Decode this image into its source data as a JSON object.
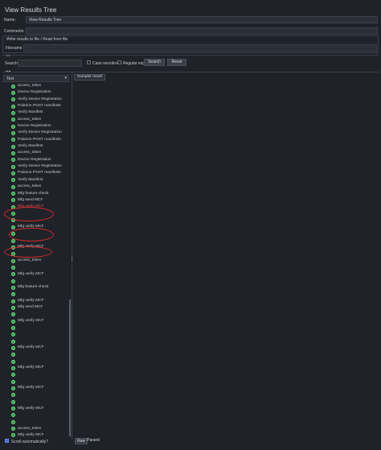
{
  "window": {
    "title": "View Results Tree"
  },
  "form": {
    "name_label": "Name:",
    "name_value": "View Results Tree",
    "comments_label": "Comments:",
    "comments_value": "",
    "file_section_label": "Write results to file / Read from file",
    "filename_label": "Filename",
    "filename_value": ""
  },
  "search": {
    "label": "Search:",
    "value": "",
    "case_sensitive_label": "Case sensitive",
    "case_sensitive_checked": false,
    "regex_label": "Regular exp.",
    "regex_checked": false,
    "search_button": "Search",
    "reset_button": "Reset"
  },
  "renderer": {
    "selected": "Text"
  },
  "result_tabs": {
    "sampler_result": "Sampler result"
  },
  "tree": {
    "items": [
      {
        "label": "access_token",
        "highlight": false
      },
      {
        "label": "Device Registration",
        "highlight": false
      },
      {
        "label": "Verify Device Registration",
        "highlight": false
      },
      {
        "label": "Polarion POST manifests",
        "highlight": false
      },
      {
        "label": "Verify Manifest",
        "highlight": false
      },
      {
        "label": "access_token",
        "highlight": false
      },
      {
        "label": "Device Registration",
        "highlight": false
      },
      {
        "label": "Verify Device Registration",
        "highlight": false
      },
      {
        "label": "Polarion POST manifests",
        "highlight": false
      },
      {
        "label": "Verify Manifest",
        "highlight": false
      },
      {
        "label": "access_token",
        "highlight": false
      },
      {
        "label": "Device Registration",
        "highlight": false
      },
      {
        "label": "Verify Device Registration",
        "highlight": false
      },
      {
        "label": "Polarion POST manifests",
        "highlight": false
      },
      {
        "label": "Verify Manifest",
        "highlight": false
      },
      {
        "label": "access_token",
        "highlight": false
      },
      {
        "label": "Mfg feature-check",
        "highlight": false
      },
      {
        "label": "Mfg send MCF",
        "highlight": false
      },
      {
        "label": "Mfg verify MCF",
        "highlight": true
      },
      {
        "label": "",
        "highlight": false
      },
      {
        "label": "",
        "highlight": false
      },
      {
        "label": "Mfg verify MCF",
        "highlight": false
      },
      {
        "label": "",
        "highlight": false
      },
      {
        "label": "",
        "highlight": false
      },
      {
        "label": "Mfg verify MCF",
        "highlight": false
      },
      {
        "label": "",
        "highlight": false
      },
      {
        "label": "access_token",
        "highlight": false
      },
      {
        "label": "",
        "highlight": false
      },
      {
        "label": "Mfg verify MCF",
        "highlight": false
      },
      {
        "label": "",
        "highlight": false
      },
      {
        "label": "Mfg feature-check",
        "highlight": false
      },
      {
        "label": "",
        "highlight": false
      },
      {
        "label": "Mfg verify MCF",
        "highlight": false
      },
      {
        "label": "Mfg send MCF",
        "highlight": false
      },
      {
        "label": "",
        "highlight": false
      },
      {
        "label": "Mfg verify MCF",
        "highlight": false
      },
      {
        "label": "",
        "highlight": false
      },
      {
        "label": "",
        "highlight": false
      },
      {
        "label": "",
        "highlight": false
      },
      {
        "label": "Mfg verify MCF",
        "highlight": false
      },
      {
        "label": "",
        "highlight": false
      },
      {
        "label": "",
        "highlight": false
      },
      {
        "label": "Mfg verify MCF",
        "highlight": false
      },
      {
        "label": "",
        "highlight": false
      },
      {
        "label": "",
        "highlight": false
      },
      {
        "label": "Mfg verify MCF",
        "highlight": false
      },
      {
        "label": "",
        "highlight": false
      },
      {
        "label": "",
        "highlight": false
      },
      {
        "label": "Mfg verify MCF",
        "highlight": false
      },
      {
        "label": "",
        "highlight": false
      },
      {
        "label": "",
        "highlight": false
      },
      {
        "label": "access_token",
        "highlight": false
      },
      {
        "label": "Mfg verify MCF",
        "highlight": false
      }
    ]
  },
  "footer": {
    "scroll_auto_label": "Scroll automatically?",
    "scroll_auto_checked": true,
    "tab_raw": "Raw",
    "tab_parsed": "Parsed"
  },
  "colors": {
    "background": "#1f2228",
    "success_icon": "#2e9e44",
    "annotation": "#d62b2b"
  }
}
